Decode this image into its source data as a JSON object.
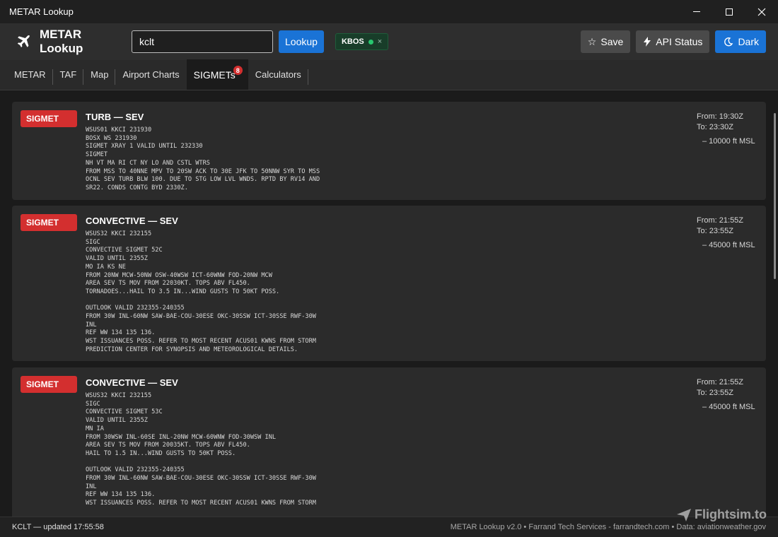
{
  "window": {
    "title": "METAR Lookup"
  },
  "header": {
    "app_title": "METAR Lookup",
    "search_value": "kclt",
    "lookup_label": "Lookup",
    "chip_label": "KBOS",
    "chip_close": "×",
    "save_label": "Save",
    "api_label": "API Status",
    "theme_label": "Dark",
    "accent_color": "#1a73d6"
  },
  "tabs": [
    {
      "label": "METAR"
    },
    {
      "label": "TAF"
    },
    {
      "label": "Map"
    },
    {
      "label": "Airport Charts"
    },
    {
      "label": "SIGMETs",
      "badge": "8",
      "active": true
    },
    {
      "label": "Calculators"
    }
  ],
  "sigmets": [
    {
      "badge": "SIGMET",
      "title": "TURB  —  SEV",
      "raw": "WSUS01 KKCI 231930\nBOSX WS 231930\nSIGMET XRAY 1 VALID UNTIL 232330\nSIGMET\nNH VT MA RI CT NY LO AND CSTL WTRS\nFROM MSS TO 40NNE MPV TO 20SW ACK TO 30E JFK TO 50NNW SYR TO MSS\nOCNL SEV TURB BLW 100. DUE TO STG LOW LVL WNDS. RPTD BY RV14 AND\nSR22. CONDS CONTG BYD 2330Z.",
      "from": "From: 19:30Z",
      "to": "To: 23:30Z",
      "alt": "– 10000  ft MSL"
    },
    {
      "badge": "SIGMET",
      "title": "CONVECTIVE  —  SEV",
      "raw": "WSUS32 KKCI 232155\nSIGC\nCONVECTIVE SIGMET 52C\nVALID UNTIL 2355Z\nMO IA KS NE\nFROM 20NW MCW-50NW OSW-40WSW ICT-60WNW FOD-20NW MCW\nAREA SEV TS MOV FROM 22030KT. TOPS ABV FL450.\nTORNADOES...HAIL TO 3.5 IN...WIND GUSTS TO 50KT POSS.\n\nOUTLOOK VALID 232355-240355\nFROM 30W INL-60NW SAW-BAE-COU-30ESE OKC-30SSW ICT-30SSE RWF-30W\nINL\nREF WW 134 135 136.\nWST ISSUANCES POSS. REFER TO MOST RECENT ACUS01 KWNS FROM STORM\nPREDICTION CENTER FOR SYNOPSIS AND METEOROLOGICAL DETAILS.",
      "from": "From: 21:55Z",
      "to": "To: 23:55Z",
      "alt": "– 45000  ft MSL"
    },
    {
      "badge": "SIGMET",
      "title": "CONVECTIVE  —  SEV",
      "raw": "WSUS32 KKCI 232155\nSIGC\nCONVECTIVE SIGMET 53C\nVALID UNTIL 2355Z\nMN IA\nFROM 30WSW INL-60SE INL-20NW MCW-60WNW FOD-30WSW INL\nAREA SEV TS MOV FROM 20035KT. TOPS ABV FL450.\nHAIL TO 1.5 IN...WIND GUSTS TO 50KT POSS.\n\nOUTLOOK VALID 232355-240355\nFROM 30W INL-60NW SAW-BAE-COU-30ESE OKC-30SSW ICT-30SSE RWF-30W\nINL\nREF WW 134 135 136.\nWST ISSUANCES POSS. REFER TO MOST RECENT ACUS01 KWNS FROM STORM",
      "from": "From: 21:55Z",
      "to": "To: 23:55Z",
      "alt": "– 45000  ft MSL"
    }
  ],
  "status": {
    "left": "KCLT — updated 17:55:58",
    "right": "METAR Lookup v2.0 • Farrand Tech Services - farrandtech.com • Data: aviationweather.gov"
  },
  "watermark": "Flightsim.to",
  "icons": {
    "logo": "airplane-icon",
    "save": "star-icon",
    "api": "bolt-icon",
    "theme": "moon-icon"
  },
  "colors": {
    "sigmet_badge": "#d32f2f",
    "chip_dot": "#28c76f",
    "card_bg": "#2b2b2b"
  }
}
